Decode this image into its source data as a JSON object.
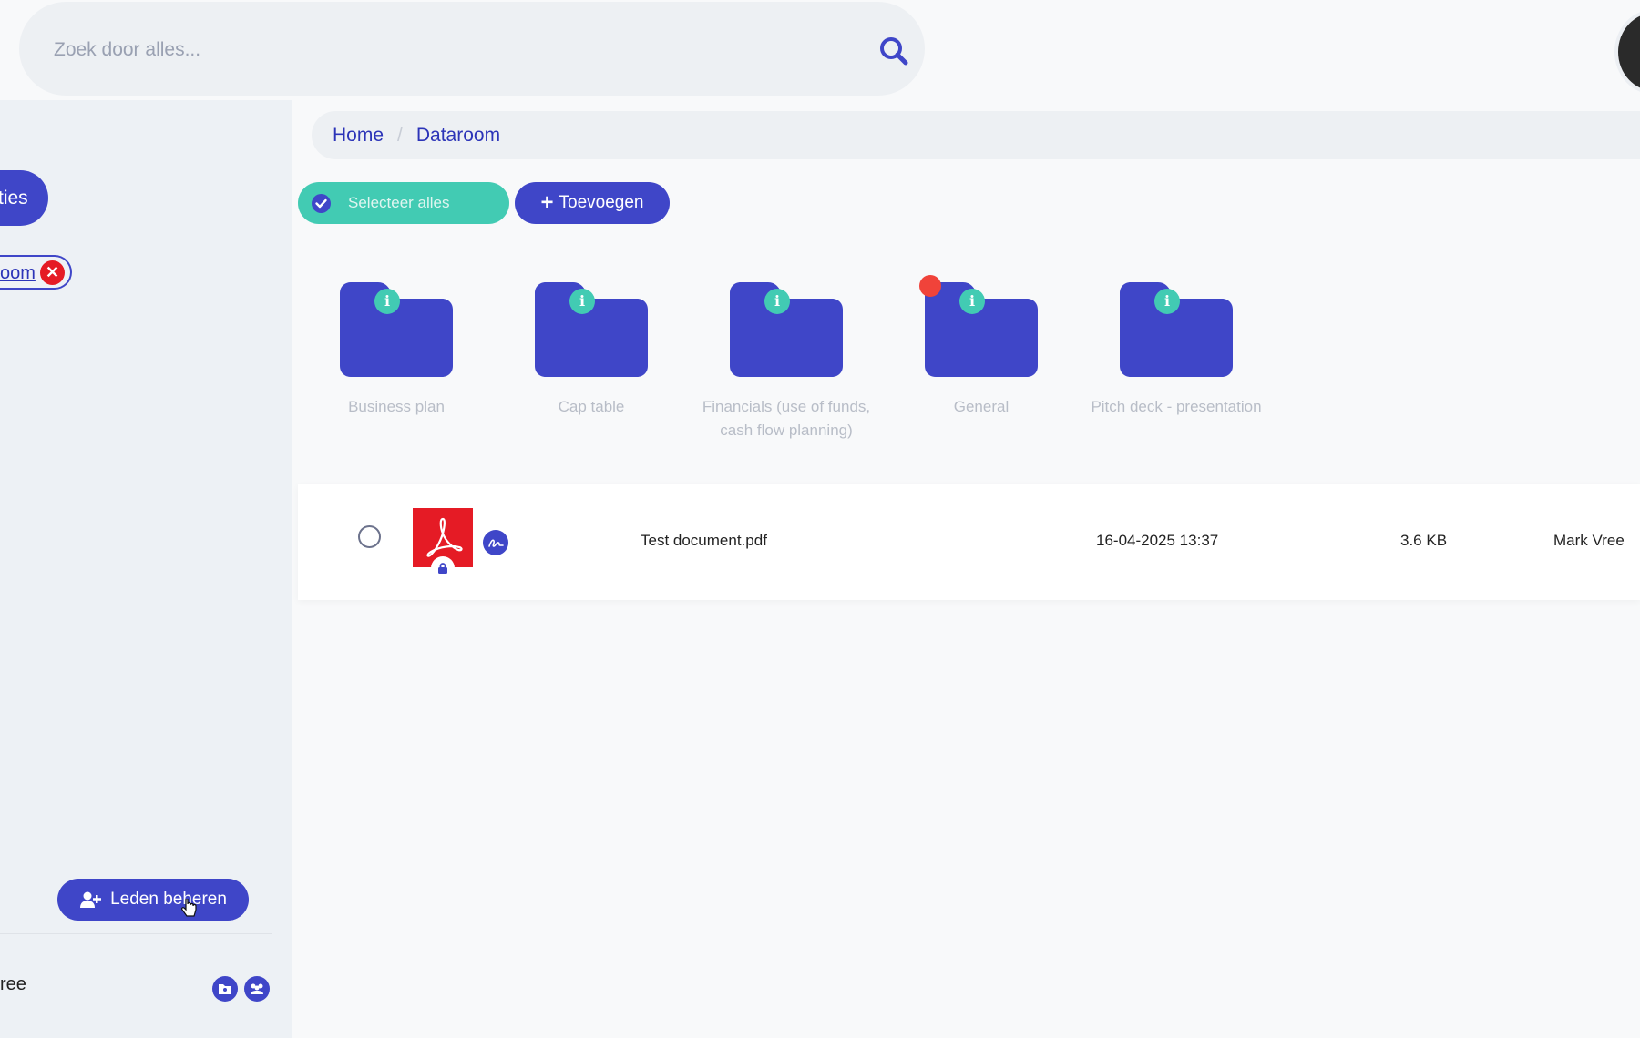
{
  "search": {
    "placeholder": "Zoek door alles..."
  },
  "sidebar": {
    "active_item": "ties",
    "chip_label": "oom",
    "chip_close": "✕",
    "members_button": "Leden beheren",
    "user_name": "ree"
  },
  "breadcrumb": {
    "home": "Home",
    "separator": "/",
    "current": "Dataroom"
  },
  "toolbar": {
    "select_all": "Selecteer alles",
    "add_label": "Toevoegen",
    "add_icon": "+"
  },
  "folders": [
    {
      "name": "Business plan",
      "notification": false
    },
    {
      "name": "Cap table",
      "notification": false
    },
    {
      "name": "Financials (use of funds, cash flow planning)",
      "notification": false
    },
    {
      "name": "General",
      "notification": true
    },
    {
      "name": "Pitch deck - presentation",
      "notification": false
    }
  ],
  "folder_info_glyph": "i",
  "files": [
    {
      "name": "Test document.pdf",
      "date": "16-04-2025 13:37",
      "size": "3.6 KB",
      "owner": "Mark Vree"
    }
  ],
  "colors": {
    "accent": "#3f46c8",
    "teal": "#42cbb3",
    "danger": "#e51b25",
    "notification": "#f0433a"
  },
  "icons": {
    "search": "search-icon",
    "check": "check-circle-icon",
    "add": "plus-icon",
    "info": "info-icon",
    "pdf": "pdf-file-icon",
    "lock": "lock-icon",
    "signature": "signature-icon",
    "members": "add-user-icon",
    "folder": "folder-icon"
  }
}
